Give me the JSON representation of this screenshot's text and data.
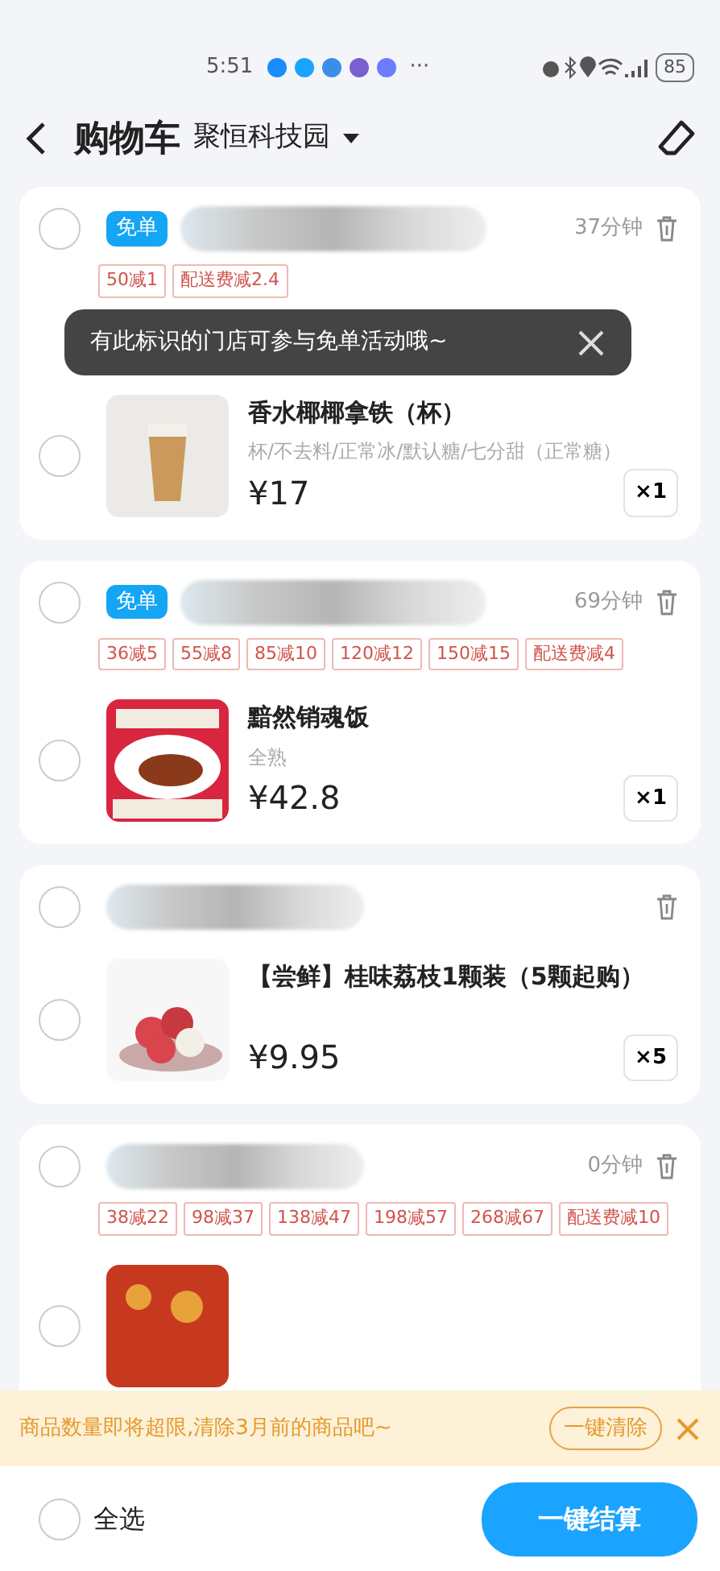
{
  "status_bar": {
    "time": "5:51",
    "more": "···",
    "battery": "85"
  },
  "header": {
    "title": "购物车",
    "location": "聚恒科技园"
  },
  "stores": [
    {
      "selected": false,
      "free_badge": "免单",
      "time": "37分钟",
      "promotions": [
        "50减1",
        "配送费减2.4"
      ],
      "tooltip": "有此标识的门店可参与免单活动哦~",
      "items": [
        {
          "selected": false,
          "name": "香水椰椰拿铁（杯）",
          "spec": "杯/不去料/正常冰/默认糖/七分甜（正常糖）",
          "price": "¥17",
          "quantity": "×1"
        }
      ]
    },
    {
      "selected": false,
      "free_badge": "免单",
      "time": "69分钟",
      "promotions": [
        "36减5",
        "55减8",
        "85减10",
        "120减12",
        "150减15",
        "配送费减4"
      ],
      "items": [
        {
          "selected": false,
          "name": "黯然销魂饭",
          "spec": "全熟",
          "price": "¥42.8",
          "quantity": "×1"
        }
      ]
    },
    {
      "selected": false,
      "items": [
        {
          "selected": false,
          "name": "【尝鲜】桂味荔枝1颗装（5颗起购）",
          "price": "¥9.95",
          "quantity": "×5"
        }
      ]
    },
    {
      "selected": false,
      "time": "0分钟",
      "promotions": [
        "38减22",
        "98减37",
        "138减47",
        "198减57",
        "268减67",
        "配送费减10"
      ],
      "items": [
        {
          "selected": false
        }
      ]
    }
  ],
  "banner": {
    "text": "商品数量即将超限,清除3月前的商品吧~",
    "button": "一键清除"
  },
  "footer": {
    "select_all": {
      "label": "全选",
      "checked": false
    },
    "checkout": "一键结算"
  }
}
